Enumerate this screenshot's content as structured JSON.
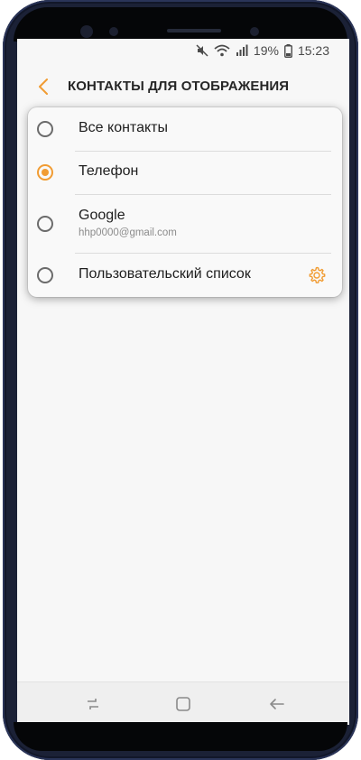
{
  "status_bar": {
    "battery_percent": "19%",
    "time": "15:23",
    "icons": [
      "mute-icon",
      "wifi-icon",
      "signal-icon",
      "battery-icon"
    ]
  },
  "header": {
    "back_icon": "back-arrow-icon",
    "title": "КОНТАКТЫ ДЛЯ ОТОБРАЖЕНИЯ"
  },
  "options": [
    {
      "label": "Все контакты",
      "selected": false
    },
    {
      "label": "Телефон",
      "selected": true
    },
    {
      "label": "Google",
      "account": "hhp0000@gmail.com",
      "selected": false
    },
    {
      "label": "Пользовательский список",
      "selected": false,
      "settings_icon": "gear-icon"
    }
  ],
  "colors": {
    "accent": "#f19c33",
    "background": "#f7f7f7"
  },
  "nav_bar": {
    "icons": [
      "recent-apps-icon",
      "home-icon",
      "back-icon"
    ]
  }
}
